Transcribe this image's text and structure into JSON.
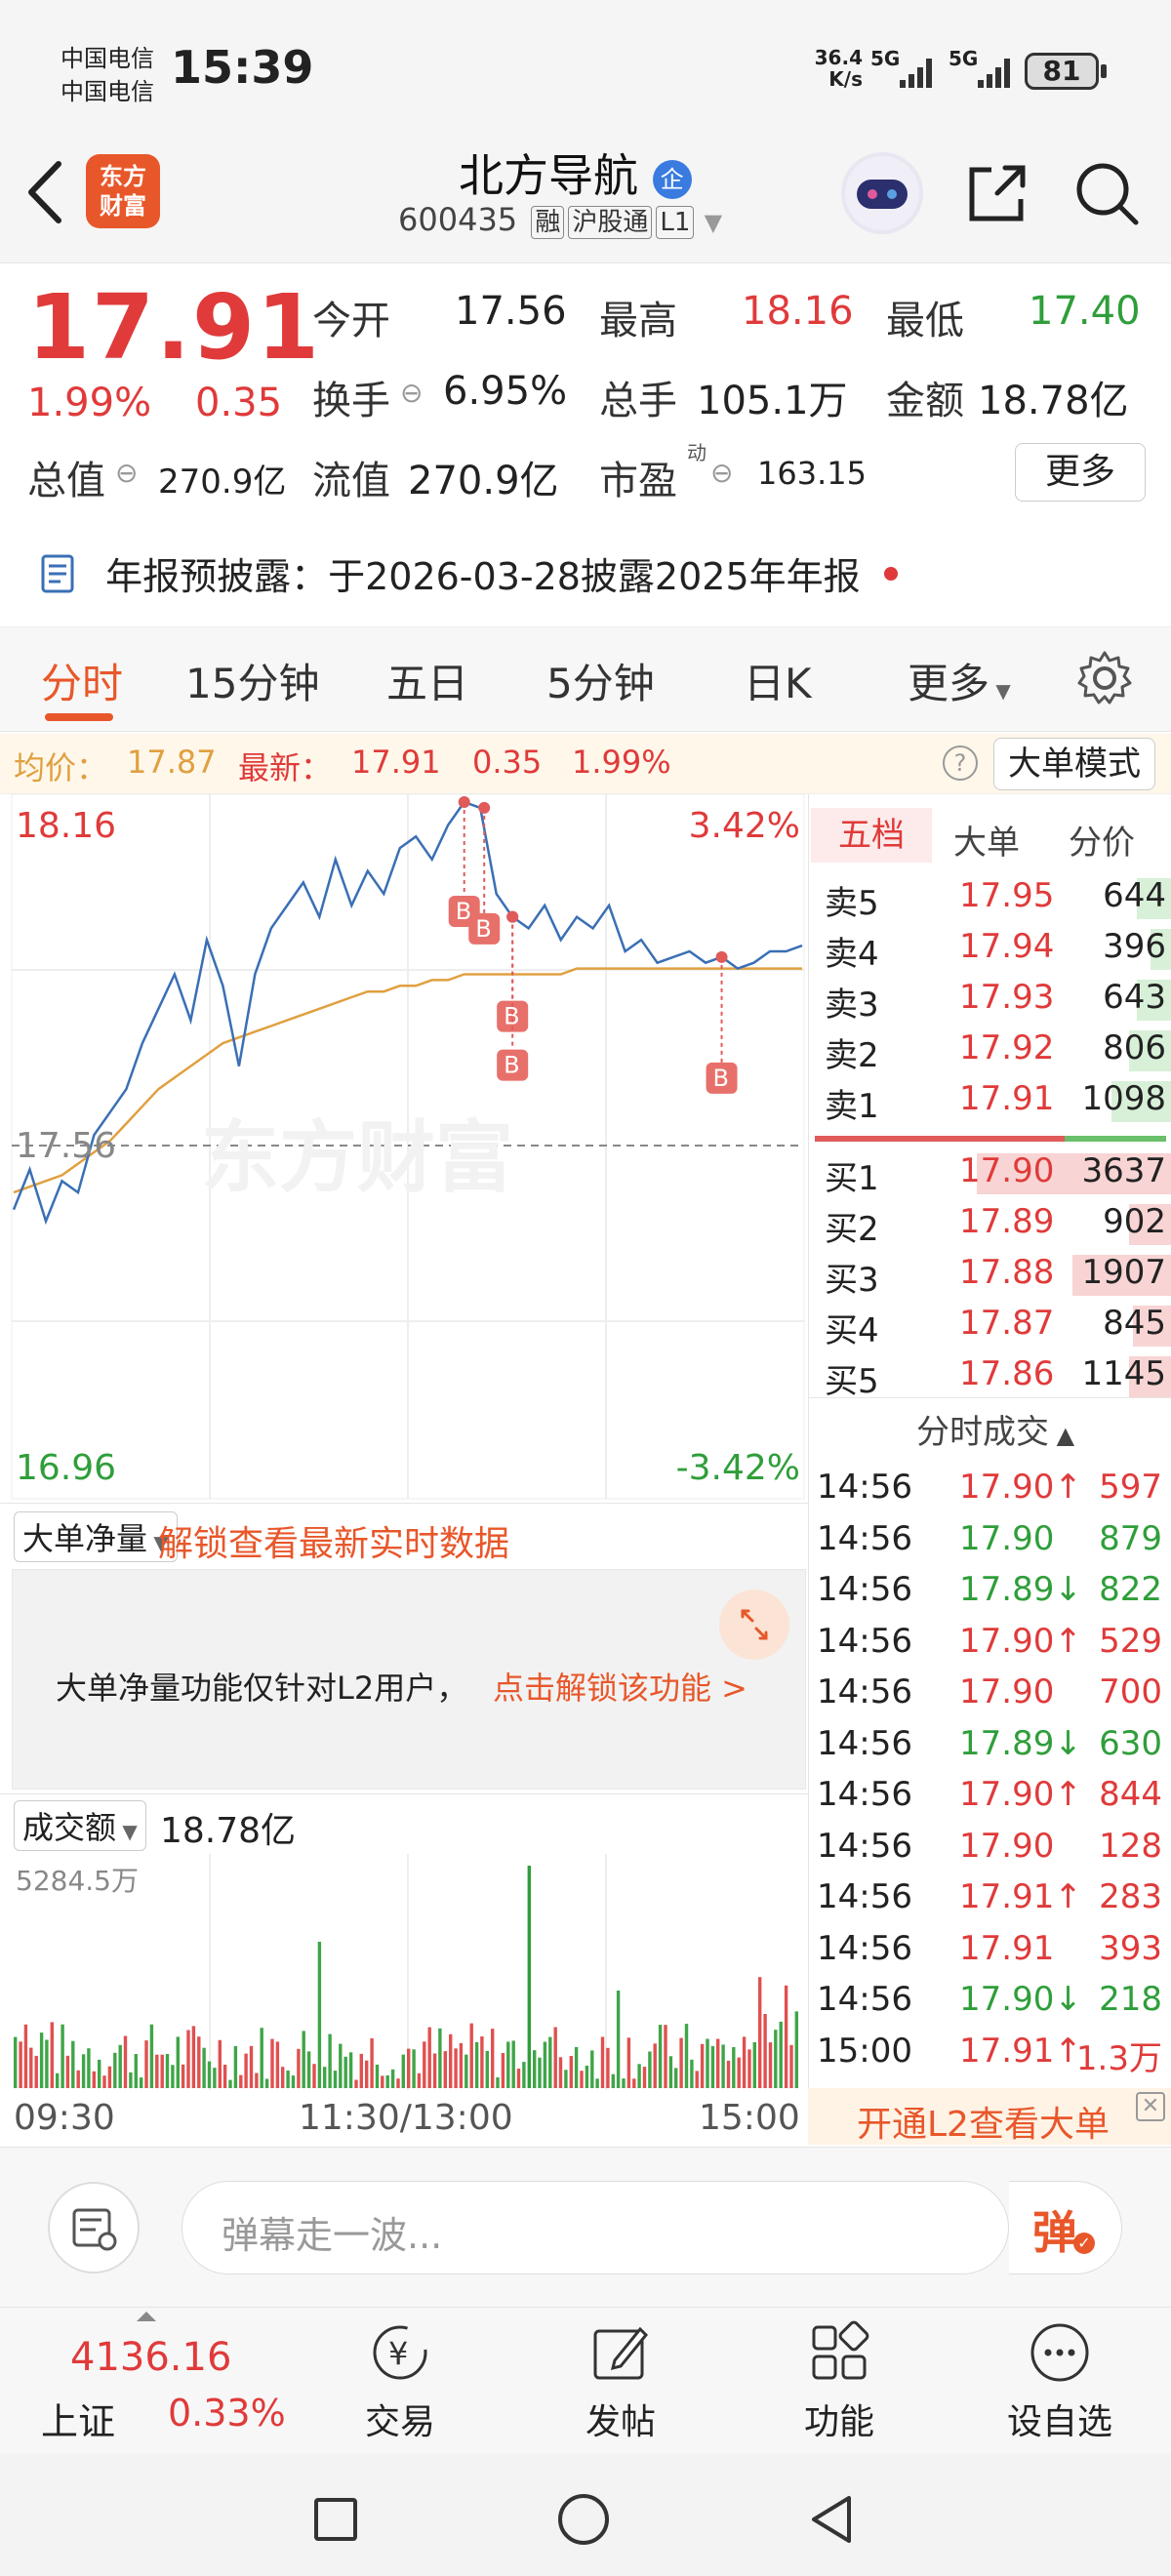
{
  "status": {
    "carrier1": "中国电信",
    "carrier2": "中国电信",
    "time": "15:39",
    "net_speed": "36.4",
    "net_unit": "K/s",
    "signal1": "5G",
    "signal2": "5G",
    "battery": "81"
  },
  "header": {
    "logo_line1": "东方",
    "logo_line2": "财富",
    "name": "北方导航",
    "badge": "企",
    "code": "600435",
    "tags": [
      "融",
      "沪股通",
      "L1"
    ]
  },
  "quote": {
    "price": "17.91",
    "pct": "1.99%",
    "change": "0.35",
    "open_label": "今开",
    "open": "17.56",
    "high_label": "最高",
    "high": "18.16",
    "low_label": "最低",
    "low": "17.40",
    "turnover_label": "换手",
    "turnover": "6.95%",
    "volume_label": "总手",
    "volume": "105.1万",
    "amount_label": "金额",
    "amount": "18.78亿",
    "mktcap_label": "总值",
    "mktcap": "270.9亿",
    "float_label": "流值",
    "float": "270.9亿",
    "pe_label": "市盈",
    "pe_sup": "动",
    "pe": "163.15",
    "more": "更多"
  },
  "notice": {
    "text": "年报预披露：于2026-03-28披露2025年年报"
  },
  "tabs": [
    "分时",
    "15分钟",
    "五日",
    "5分钟",
    "日K"
  ],
  "tabs_more": "更多",
  "info_line": {
    "avg_label": "均价：",
    "avg": "17.87",
    "latest_label": "最新：",
    "latest": "17.91",
    "change": "0.35",
    "pct": "1.99%",
    "big_order_mode": "大单模式"
  },
  "chart_data": {
    "type": "line",
    "y_top": "18.16",
    "y_top_pct": "3.42%",
    "y_bottom": "16.96",
    "y_bottom_pct": "-3.42%",
    "prev_close": "17.56",
    "watermark": "东方财富",
    "ylim": [
      16.96,
      18.16
    ],
    "series": [
      {
        "name": "price",
        "values": [
          17.45,
          17.52,
          17.43,
          17.5,
          17.48,
          17.58,
          17.62,
          17.66,
          17.74,
          17.8,
          17.86,
          17.78,
          17.92,
          17.84,
          17.7,
          17.86,
          17.94,
          17.98,
          18.02,
          17.96,
          18.06,
          17.98,
          18.04,
          18.0,
          18.08,
          18.1,
          18.06,
          18.12,
          18.16,
          18.15,
          18.0,
          17.96,
          17.94,
          17.98,
          17.92,
          17.96,
          17.94,
          17.98,
          17.9,
          17.92,
          17.88,
          17.89,
          17.9,
          17.88,
          17.89,
          17.87,
          17.88,
          17.9,
          17.9,
          17.91
        ]
      },
      {
        "name": "avg",
        "values": [
          17.48,
          17.49,
          17.5,
          17.51,
          17.53,
          17.55,
          17.57,
          17.6,
          17.63,
          17.66,
          17.68,
          17.7,
          17.72,
          17.74,
          17.75,
          17.76,
          17.77,
          17.78,
          17.79,
          17.8,
          17.81,
          17.82,
          17.83,
          17.83,
          17.84,
          17.84,
          17.85,
          17.85,
          17.86,
          17.86,
          17.86,
          17.86,
          17.86,
          17.86,
          17.86,
          17.87,
          17.87,
          17.87,
          17.87,
          17.87,
          17.87,
          17.87,
          17.87,
          17.87,
          17.87,
          17.87,
          17.87,
          17.87,
          17.87,
          17.87
        ]
      }
    ],
    "markers": [
      "B",
      "B",
      "B",
      "B",
      "B"
    ]
  },
  "order_book": {
    "tabs": [
      "五档",
      "大单",
      "分价"
    ],
    "sells": [
      {
        "label": "卖5",
        "price": "17.95",
        "vol": "644",
        "ratio": 0.1
      },
      {
        "label": "卖4",
        "price": "17.94",
        "vol": "396",
        "ratio": 0.06
      },
      {
        "label": "卖3",
        "price": "17.93",
        "vol": "643",
        "ratio": 0.1
      },
      {
        "label": "卖2",
        "price": "17.92",
        "vol": "806",
        "ratio": 0.12
      },
      {
        "label": "卖1",
        "price": "17.91",
        "vol": "1098",
        "ratio": 0.17
      }
    ],
    "buys": [
      {
        "label": "买1",
        "price": "17.90",
        "vol": "3637",
        "ratio": 0.55
      },
      {
        "label": "买2",
        "price": "17.89",
        "vol": "902",
        "ratio": 0.12
      },
      {
        "label": "买3",
        "price": "17.88",
        "vol": "1907",
        "ratio": 0.28
      },
      {
        "label": "买4",
        "price": "17.87",
        "vol": "845",
        "ratio": 0.11
      },
      {
        "label": "买5",
        "price": "17.86",
        "vol": "1145",
        "ratio": 0.12
      }
    ]
  },
  "trades": {
    "title": "分时成交",
    "rows": [
      {
        "time": "14:56",
        "price": "17.90",
        "dir": "↑",
        "vol": "597",
        "c": "red"
      },
      {
        "time": "14:56",
        "price": "17.90",
        "dir": "",
        "vol": "879",
        "c": "green"
      },
      {
        "time": "14:56",
        "price": "17.89",
        "dir": "↓",
        "vol": "822",
        "c": "green"
      },
      {
        "time": "14:56",
        "price": "17.90",
        "dir": "↑",
        "vol": "529",
        "c": "red"
      },
      {
        "time": "14:56",
        "price": "17.90",
        "dir": "",
        "vol": "700",
        "c": "red"
      },
      {
        "time": "14:56",
        "price": "17.89",
        "dir": "↓",
        "vol": "630",
        "c": "green"
      },
      {
        "time": "14:56",
        "price": "17.90",
        "dir": "↑",
        "vol": "844",
        "c": "red"
      },
      {
        "time": "14:56",
        "price": "17.90",
        "dir": "",
        "vol": "128",
        "c": "red"
      },
      {
        "time": "14:56",
        "price": "17.91",
        "dir": "↑",
        "vol": "283",
        "c": "red"
      },
      {
        "time": "14:56",
        "price": "17.91",
        "dir": "",
        "vol": "393",
        "c": "red"
      },
      {
        "time": "14:56",
        "price": "17.90",
        "dir": "↓",
        "vol": "218",
        "c": "green"
      },
      {
        "time": "15:00",
        "price": "17.91",
        "dir": "↑",
        "vol": "1.3万",
        "c": "red"
      }
    ]
  },
  "net_flow": {
    "dropdown": "大单净量",
    "unlock_link": "解锁查看最新实时数据",
    "lock_text": "大单净量功能仅针对L2用户，",
    "lock_link": "点击解锁该功能 >"
  },
  "volume": {
    "dropdown": "成交额",
    "total": "18.78亿",
    "max_label": "5284.5万"
  },
  "time_axis": {
    "start": "09:30",
    "mid": "11:30/13:00",
    "end": "15:00"
  },
  "l2_promo": "开通L2查看大单",
  "danmu": {
    "placeholder": "弹幕走一波...",
    "send": "弹"
  },
  "bottom_nav": {
    "index_value": "4136.16",
    "index_name": "上证",
    "index_pct": "0.33%",
    "items": [
      "交易",
      "发帖",
      "功能",
      "设自选"
    ]
  },
  "colors": {
    "up": "#e03a3a",
    "down": "#2f9e3a",
    "accent": "#e8572a",
    "price_line": "#3a6fb5",
    "avg_line": "#e0a040"
  }
}
